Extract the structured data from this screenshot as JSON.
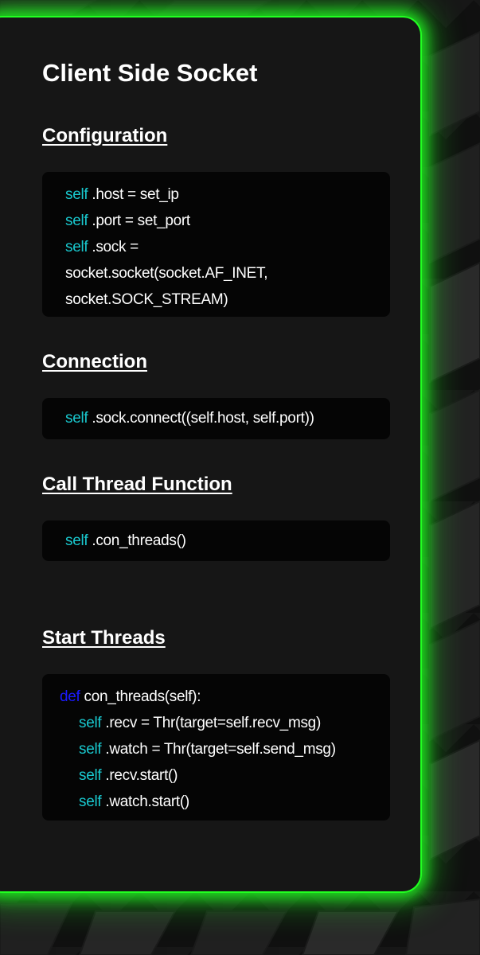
{
  "title": "Client Side Socket",
  "sections": [
    {
      "heading": "Configuration",
      "lines": [
        {
          "kw": "self",
          "text": " .host = set_ip"
        },
        {
          "kw": "self",
          "text": " .port = set_port"
        },
        {
          "kw": "self",
          "text": " .sock ="
        },
        {
          "kw": "",
          "text": "socket.socket(socket.AF_INET,"
        },
        {
          "kw": "",
          "text": "socket.SOCK_STREAM)"
        }
      ]
    },
    {
      "heading": "Connection",
      "lines": [
        {
          "kw": "self",
          "text": " .sock.connect((self.host, self.port))"
        }
      ]
    },
    {
      "heading": "Call Thread Function",
      "lines": [
        {
          "kw": "self",
          "text": " .con_threads()"
        }
      ]
    },
    {
      "heading": "Start Threads",
      "def_kw": "def",
      "def_text": " con_threads(self):",
      "lines": [
        {
          "kw": "self",
          "text": " .recv = Thr(target=self.recv_msg)"
        },
        {
          "kw": "self",
          "text": " .watch = Thr(target=self.send_msg)"
        },
        {
          "kw": "self",
          "text": " .recv.start()"
        },
        {
          "kw": "self",
          "text": " .watch.start()"
        }
      ]
    }
  ],
  "colors": {
    "accent_glow": "#21ff21",
    "card": "#161616",
    "code_bg": "#050505",
    "self_keyword": "#19c8ce",
    "def_keyword": "#1b1bff"
  }
}
